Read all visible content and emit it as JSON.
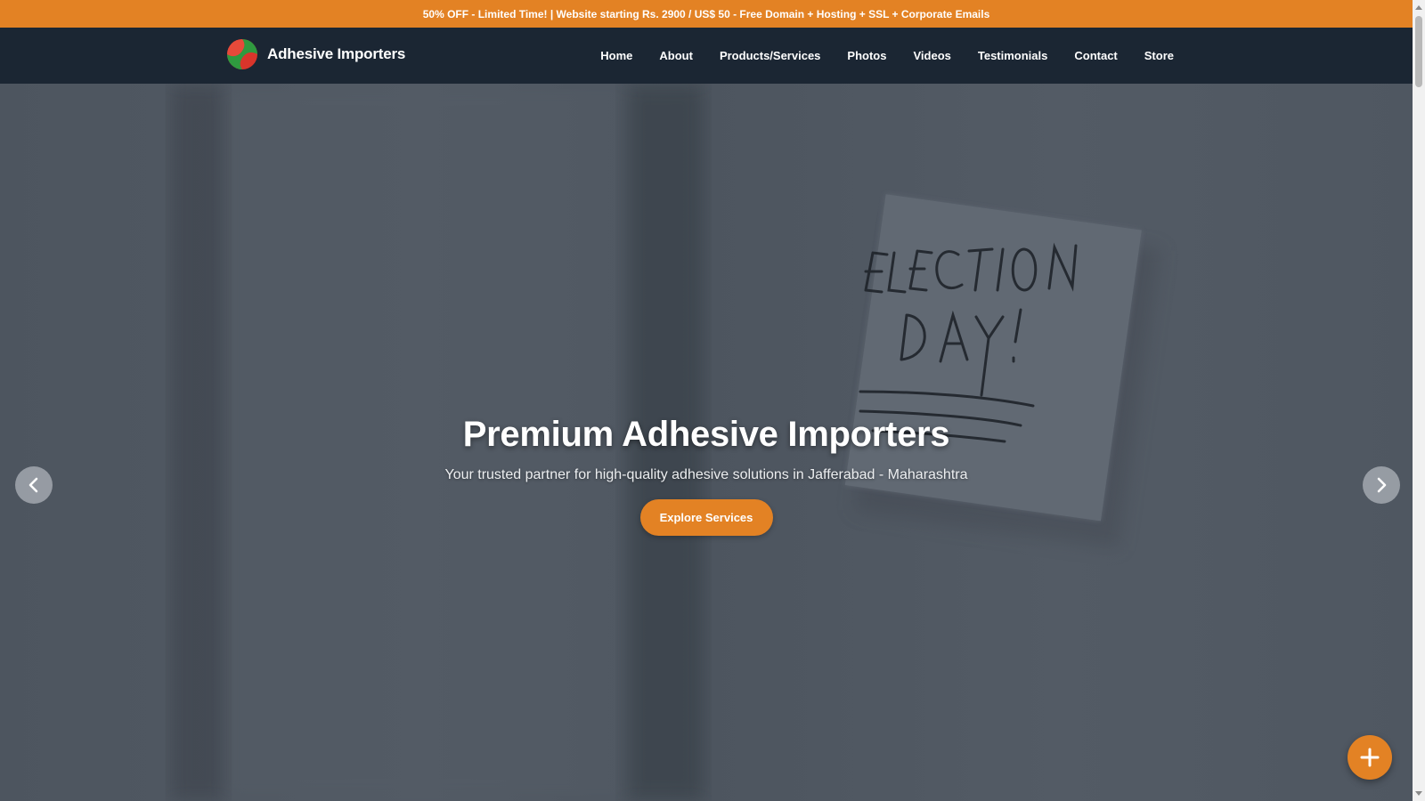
{
  "promo": {
    "text": "50% OFF - Limited Time! | Website starting Rs. 2900 / US$ 50 - Free Domain + Hosting + SSL + Corporate Emails"
  },
  "header": {
    "brand_name": "Adhesive Importers",
    "logo_icon": "brand-logo-icon"
  },
  "nav": {
    "items": [
      {
        "label": "Home"
      },
      {
        "label": "About"
      },
      {
        "label": "Products/Services"
      },
      {
        "label": "Photos"
      },
      {
        "label": "Videos"
      },
      {
        "label": "Testimonials"
      },
      {
        "label": "Contact"
      },
      {
        "label": "Store"
      }
    ]
  },
  "hero": {
    "title": "Premium Adhesive Importers",
    "subtitle": "Your trusted partner for high-quality adhesive solutions in Jafferabad - Maharashtra",
    "cta_label": "Explore Services",
    "background_note_text": "ELECTION DAY!",
    "prev_icon": "chevron-left-icon",
    "next_icon": "chevron-right-icon"
  },
  "fab": {
    "icon": "plus-icon"
  },
  "colors": {
    "accent": "#e38224",
    "navbar": "#1b2633",
    "hero_overlay": "#4d555f"
  }
}
